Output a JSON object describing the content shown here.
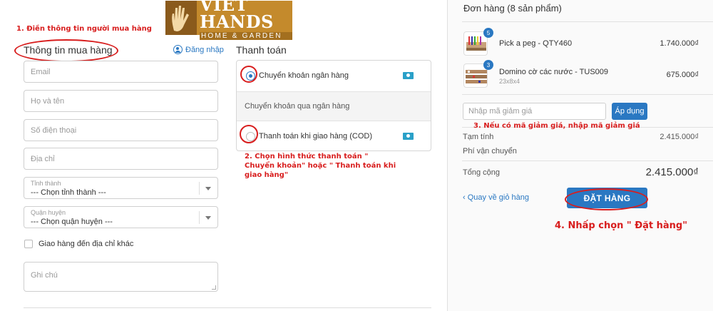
{
  "logo": {
    "text": "VIET HANDS",
    "subtext": "HOME & GARDEN"
  },
  "annotations": {
    "step1": "1. Điền thông tin người mua hàng",
    "step2": "2. Chọn hình thức thanh toán \" Chuyển khoản\" hoặc \" Thanh toán khi giao hàng\"",
    "step3": "3. Nếu có mã giảm giá, nhập mã giảm giá",
    "step4": "4. Nhấp chọn \" Đặt hàng\"",
    "highlight_color": "#d81d1d"
  },
  "buyer": {
    "title": "Thông tin mua hàng",
    "login_label": "Đăng nhập",
    "email_placeholder": "Email",
    "name_placeholder": "Họ và tên",
    "phone_placeholder": "Số điện thoại",
    "address_placeholder": "Địa chỉ",
    "city_label": "Tỉnh thành",
    "city_value": "--- Chọn tỉnh thành ---",
    "district_label": "Quận huyện",
    "district_value": "--- Chọn quận huyện ---",
    "ship_other_label": "Giao hàng đến địa chỉ khác",
    "note_placeholder": "Ghi chú"
  },
  "payment": {
    "title": "Thanh toán",
    "options": [
      {
        "label": "Chuyển khoản ngân hàng",
        "selected": true,
        "icon": "money-icon"
      },
      {
        "label": "Thanh toán khi giao hàng (COD)",
        "selected": false,
        "icon": "money-icon"
      }
    ],
    "bank_desc": "Chuyển khoản qua ngân hàng"
  },
  "order": {
    "title": "Đơn hàng (8 sản phẩm)",
    "items": [
      {
        "name": "Pick a peg - QTY460",
        "variant": "",
        "qty": "5",
        "price": "1.740.000₫"
      },
      {
        "name": "Domino cờ các nước - TUS009",
        "variant": "23x8x4",
        "qty": "3",
        "price": "675.000₫"
      }
    ],
    "discount_placeholder": "Nhập mã giảm giá",
    "apply_label": "Áp dụng",
    "subtotal_label": "Tạm tính",
    "subtotal_value": "2.415.000₫",
    "shipping_label": "Phí vận chuyển",
    "shipping_value": "",
    "total_label": "Tổng cộng",
    "total_value": "2.415.000₫",
    "back_label": "Quay về giỏ hàng",
    "submit_label": "ĐẶT HÀNG",
    "accent_color": "#2a78c2"
  }
}
